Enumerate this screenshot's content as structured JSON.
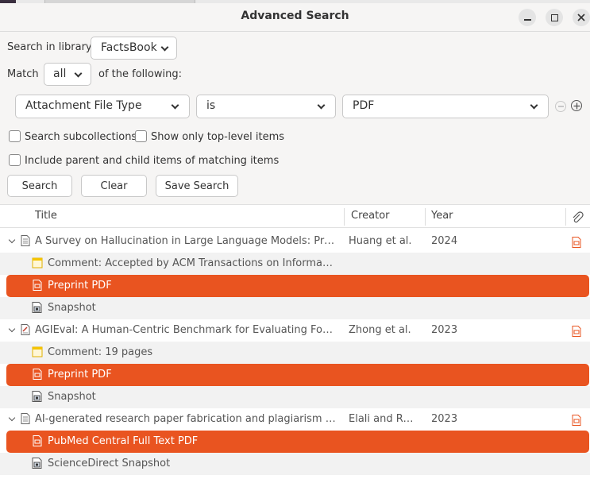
{
  "window": {
    "title": "Advanced Search"
  },
  "search": {
    "library_label": "Search in library:",
    "library_value": "FactsBook",
    "match_label": "Match",
    "match_value": "all",
    "match_suffix": "of the following:"
  },
  "condition": {
    "field": "Attachment File Type",
    "operator": "is",
    "value": "PDF"
  },
  "options": {
    "subcollections": "Search subcollections",
    "top_level": "Show only top-level items",
    "parent_child": "Include parent and child items of matching items"
  },
  "buttons": {
    "search": "Search",
    "clear": "Clear",
    "save": "Save Search"
  },
  "columns": {
    "title": "Title",
    "creator": "Creator",
    "year": "Year"
  },
  "rows": [
    {
      "kind": "parent",
      "title": "A Survey on Hallucination in Large Language Models: Principles, Taxonomy, Challenges, and Open Questions",
      "creator": "Huang et al.",
      "year": "2024",
      "icon": "document-icon"
    },
    {
      "kind": "child",
      "title": "Comment: Accepted by ACM Transactions on Information Systems (TOIS)",
      "icon": "note-icon"
    },
    {
      "kind": "selected",
      "title": "Preprint PDF",
      "icon": "pdf-icon"
    },
    {
      "kind": "child",
      "title": "Snapshot",
      "icon": "snapshot-icon"
    },
    {
      "kind": "parent",
      "title": "AGIEval: A Human-Centric Benchmark for Evaluating Foundation Models",
      "creator": "Zhong et al.",
      "year": "2023",
      "icon": "preprint-icon"
    },
    {
      "kind": "child",
      "title": "Comment: 19 pages",
      "icon": "note-icon"
    },
    {
      "kind": "selected",
      "title": "Preprint PDF",
      "icon": "pdf-icon"
    },
    {
      "kind": "child",
      "title": "Snapshot",
      "icon": "snapshot-icon"
    },
    {
      "kind": "parent",
      "title": "AI-generated research paper fabrication and plagiarism in the scientific community",
      "creator": "Elali and Rachid",
      "year": "2023",
      "icon": "document-icon"
    },
    {
      "kind": "selected",
      "title": "PubMed Central Full Text PDF",
      "icon": "pdf-icon"
    },
    {
      "kind": "child",
      "title": "ScienceDirect Snapshot",
      "icon": "snapshot-icon"
    }
  ],
  "colors": {
    "accent": "#e95420",
    "header_bg": "#f6f5f4"
  }
}
